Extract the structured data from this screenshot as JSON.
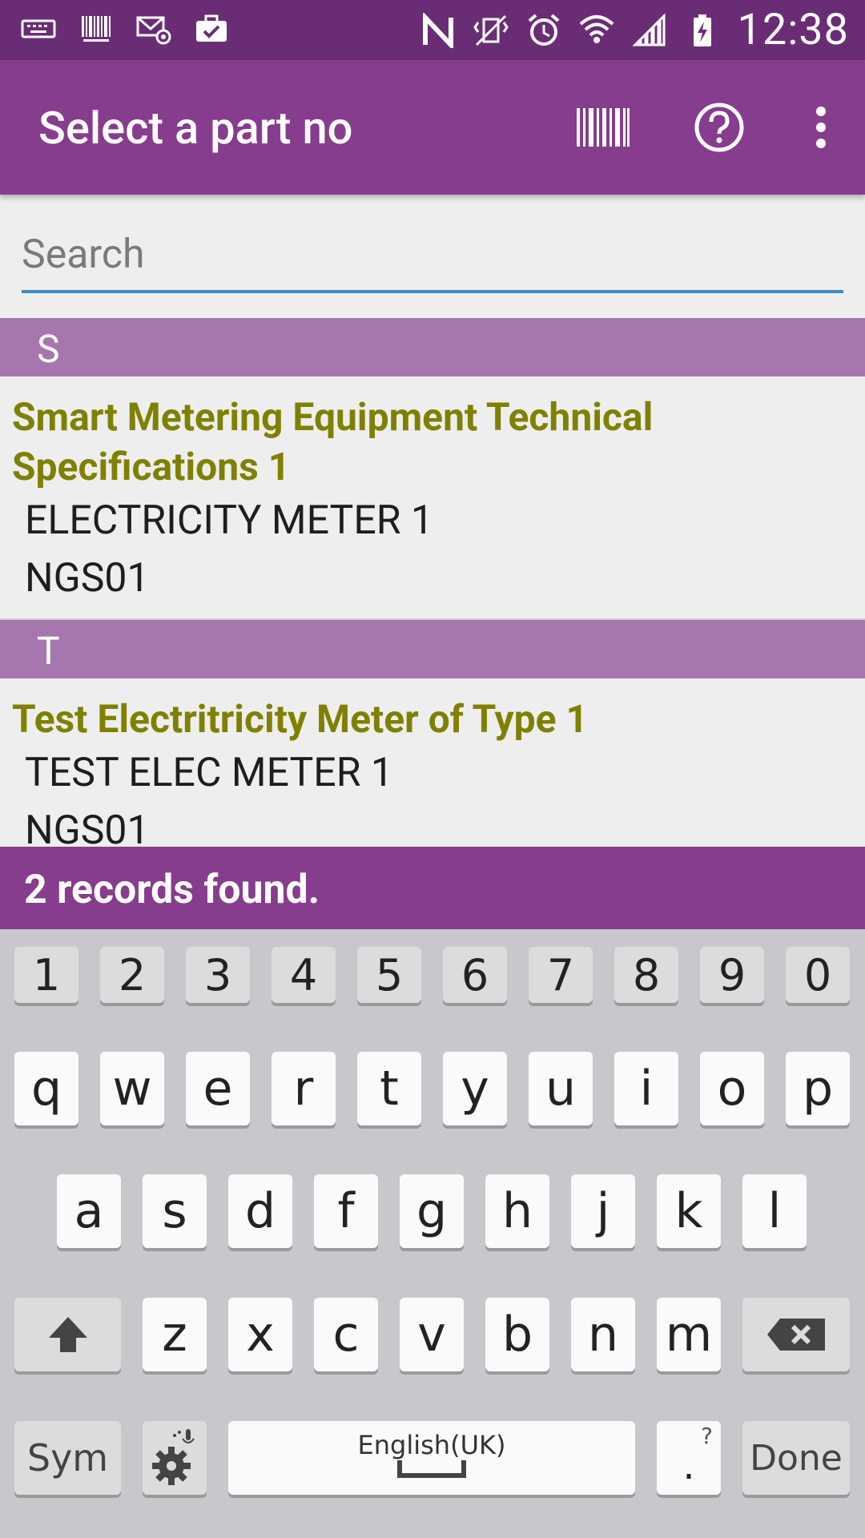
{
  "status_bar": {
    "time": "12:38",
    "left_icons": [
      "keyboard-icon",
      "barcode-icon",
      "mail-settings-icon",
      "briefcase-check-icon"
    ],
    "right_icons": [
      "nfc-icon",
      "vibrate-off-icon",
      "alarm-icon",
      "wifi-icon",
      "signal-icon",
      "battery-charging-icon"
    ]
  },
  "app_bar": {
    "title": "Select a part no",
    "actions": [
      "barcode-scan-icon",
      "help-icon",
      "overflow-menu-icon"
    ]
  },
  "search": {
    "placeholder": "Search",
    "value": ""
  },
  "list": {
    "sections": [
      {
        "header": "S",
        "items": [
          {
            "title": "Smart Metering Equipment Technical Specifications 1",
            "line1": "ELECTRICITY METER 1",
            "line2": "NGS01"
          }
        ]
      },
      {
        "header": "T",
        "items": [
          {
            "title": "Test Electritricity Meter of Type 1",
            "line1": "TEST ELEC METER 1",
            "line2": "NGS01"
          }
        ]
      }
    ]
  },
  "records_text": "2 records found.",
  "keyboard": {
    "row_numbers": [
      "1",
      "2",
      "3",
      "4",
      "5",
      "6",
      "7",
      "8",
      "9",
      "0"
    ],
    "row1": [
      "q",
      "w",
      "e",
      "r",
      "t",
      "y",
      "u",
      "i",
      "o",
      "p"
    ],
    "row2": [
      "a",
      "s",
      "d",
      "f",
      "g",
      "h",
      "j",
      "k",
      "l"
    ],
    "row3": [
      "z",
      "x",
      "c",
      "v",
      "b",
      "n",
      "m"
    ],
    "sym_label": "Sym",
    "space_label": "English(UK)",
    "period_label": ".",
    "period_hint": "?",
    "done_label": "Done"
  },
  "colors": {
    "status_bar": "#6a2d75",
    "app_bar": "#863d8d",
    "section_header": "#a677ae",
    "item_title": "#808000",
    "search_underline": "#3f8dc8"
  }
}
